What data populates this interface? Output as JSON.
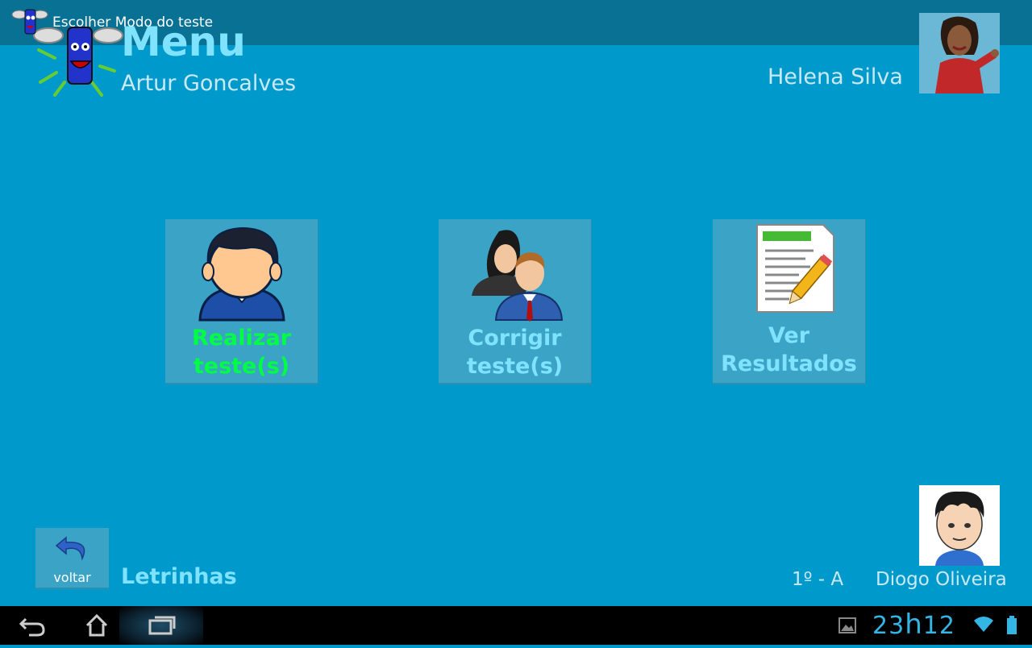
{
  "action_bar": {
    "title": "Escolher Modo do teste",
    "logo_icon": "app-logo-icon"
  },
  "header": {
    "title": "Menu",
    "student_name": "Artur Goncalves",
    "teacher_name": "Helena Silva"
  },
  "tiles": [
    {
      "label_line1": "Realizar",
      "label_line2": "teste(s)",
      "icon": "student-icon",
      "color": "#00ff44"
    },
    {
      "label_line1": "Corrigir",
      "label_line2": "teste(s)",
      "icon": "teachers-icon",
      "color": "#7fe3ff"
    },
    {
      "label_line1": "Ver",
      "label_line2": "Resultados",
      "icon": "results-document-icon",
      "color": "#7fe3ff"
    }
  ],
  "footer": {
    "back_label": "voltar",
    "brand": "Letrinhas",
    "class": "1º - A",
    "kid_name": "Diogo Oliveira"
  },
  "system_bar": {
    "time_hours": "23",
    "time_sep": "h",
    "time_minutes": "12"
  },
  "colors": {
    "background": "#0099cc",
    "accent": "#7fe3ff",
    "active_tile_text": "#00ff44"
  }
}
